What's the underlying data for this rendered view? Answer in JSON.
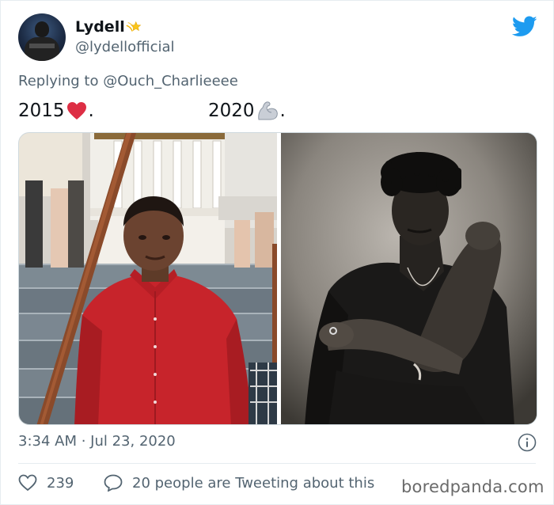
{
  "author": {
    "display_name": "Lydell",
    "handle": "@lydellofficial",
    "badge_icon": "shooting-star-icon"
  },
  "reply": {
    "prefix": "Replying to",
    "mention": "@Ouch_Charlieeee"
  },
  "tweet": {
    "segment_1_year": "2015",
    "segment_1_emoji": "red-heart-icon",
    "segment_1_suffix": ".",
    "segment_2_year": "2020",
    "segment_2_emoji": "flexed-biceps-icon",
    "segment_2_suffix": "."
  },
  "media": {
    "left_photo": "photo-2015",
    "right_photo": "photo-2020"
  },
  "meta": {
    "timestamp": "3:34 AM · Jul 23, 2020"
  },
  "engagement": {
    "likes": "239",
    "tweeting_text": "20 people are Tweeting about this"
  },
  "watermark": "boredpanda.com",
  "colors": {
    "twitter_blue": "#1d9bf0",
    "secondary_text": "#536471",
    "heart_red": "#e0245e"
  }
}
